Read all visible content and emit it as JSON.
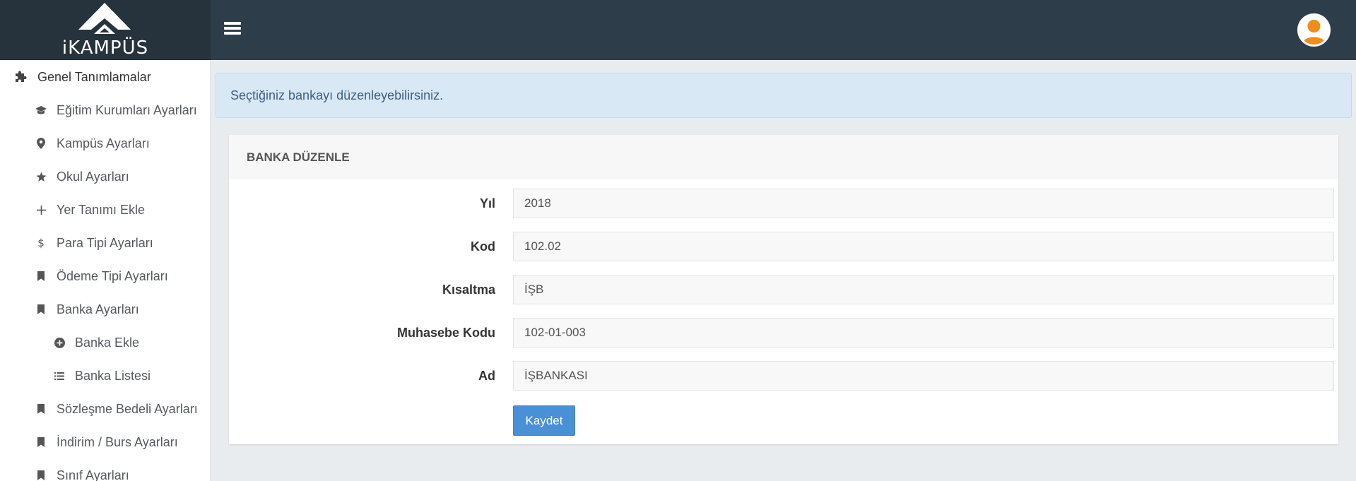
{
  "app": {
    "logo_text": "iKAMPÜS"
  },
  "sidebar": {
    "items": [
      {
        "label": "Genel Tanımlamalar",
        "icon": "puzzle-icon"
      },
      {
        "label": "Eğitim Kurumları Ayarları",
        "icon": "graduation-cap-icon"
      },
      {
        "label": "Kampüs Ayarları",
        "icon": "map-marker-icon"
      },
      {
        "label": "Okul Ayarları",
        "icon": "star-icon"
      },
      {
        "label": "Yer Tanımı Ekle",
        "icon": "plus-icon"
      },
      {
        "label": "Para Tipi Ayarları",
        "icon": "dollar-icon"
      },
      {
        "label": "Ödeme Tipi Ayarları",
        "icon": "bookmark-icon"
      },
      {
        "label": "Banka Ayarları",
        "icon": "bookmark-icon"
      },
      {
        "label": "Banka Ekle",
        "icon": "plus-circle-icon"
      },
      {
        "label": "Banka Listesi",
        "icon": "list-icon"
      },
      {
        "label": "Sözleşme Bedeli Ayarları",
        "icon": "bookmark-icon"
      },
      {
        "label": "İndirim / Burs Ayarları",
        "icon": "bookmark-icon"
      },
      {
        "label": "Sınıf Ayarları",
        "icon": "bookmark-icon"
      }
    ]
  },
  "alert": {
    "text": "Seçtiğiniz bankayı düzenleyebilirsiniz."
  },
  "panel": {
    "title": "BANKA DÜZENLE",
    "fields": [
      {
        "label": "Yıl",
        "value": "2018"
      },
      {
        "label": "Kod",
        "value": "102.02"
      },
      {
        "label": "Kısaltma",
        "value": "İŞB"
      },
      {
        "label": "Muhasebe Kodu",
        "value": "102-01-003"
      },
      {
        "label": "Ad",
        "value": "İŞBANKASI"
      }
    ],
    "save_label": "Kaydet"
  },
  "colors": {
    "topbar": "#2e3d4a",
    "accent": "#4a90d6",
    "alert_bg": "#d9e8f5",
    "avatar": "#f28c1a"
  }
}
